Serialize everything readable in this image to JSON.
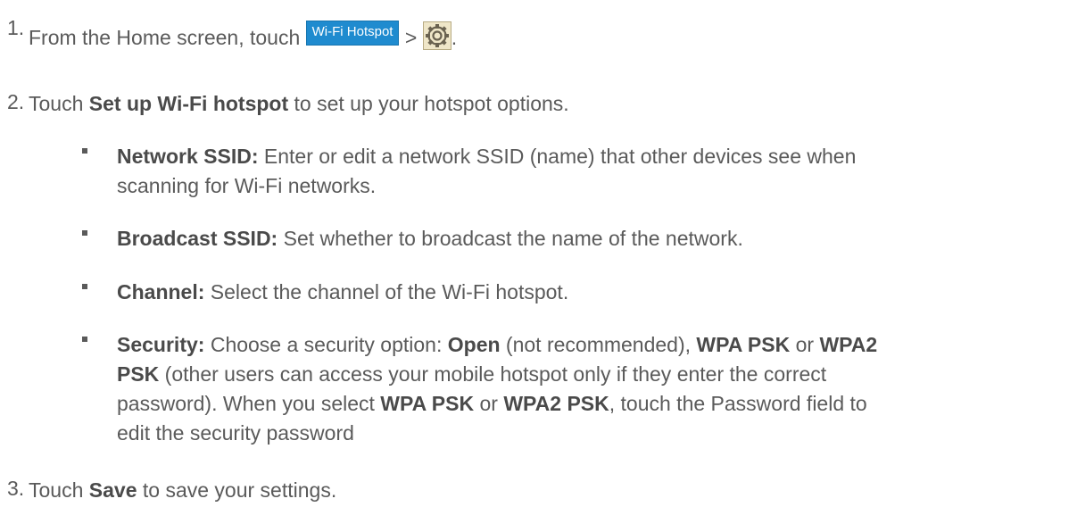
{
  "steps": [
    {
      "num": "1.",
      "pre": "From the Home screen, touch",
      "button": "Wi-Fi Hotspot",
      "sep": ">",
      "icon": "gear-icon",
      "post": "."
    },
    {
      "num": "2.",
      "pre": "Touch ",
      "bold": "Set up Wi-Fi hotspot",
      "post": " to set up your hotspot options."
    },
    {
      "num": "3.",
      "pre": "Touch ",
      "bold": "Save",
      "post": " to save your settings."
    }
  ],
  "options": [
    {
      "term": "Network SSID:",
      "line1": " Enter or edit a network SSID (name) that other devices see when",
      "line2": "scanning for Wi-Fi networks."
    },
    {
      "term": "Broadcast SSID:",
      "line1": " Set whether to broadcast the name of the network."
    },
    {
      "term": "Channel:",
      "line1": " Select the channel of the Wi-Fi hotspot."
    },
    {
      "term": "Security:",
      "a": " Choose a security option: ",
      "open": "Open",
      "b": " (not recommended), ",
      "wpa": "WPA PSK",
      "c": " or ",
      "wpa2": "WPA2",
      "psk": "PSK",
      "d": " (other users can access your mobile hotspot only if they enter the correct",
      "e": "password). When you select ",
      "wpa_b": "WPA PSK",
      "f": " or ",
      "wpa2_b": "WPA2 PSK",
      "g": ", touch the Password field to",
      "h": "edit the security password"
    }
  ]
}
